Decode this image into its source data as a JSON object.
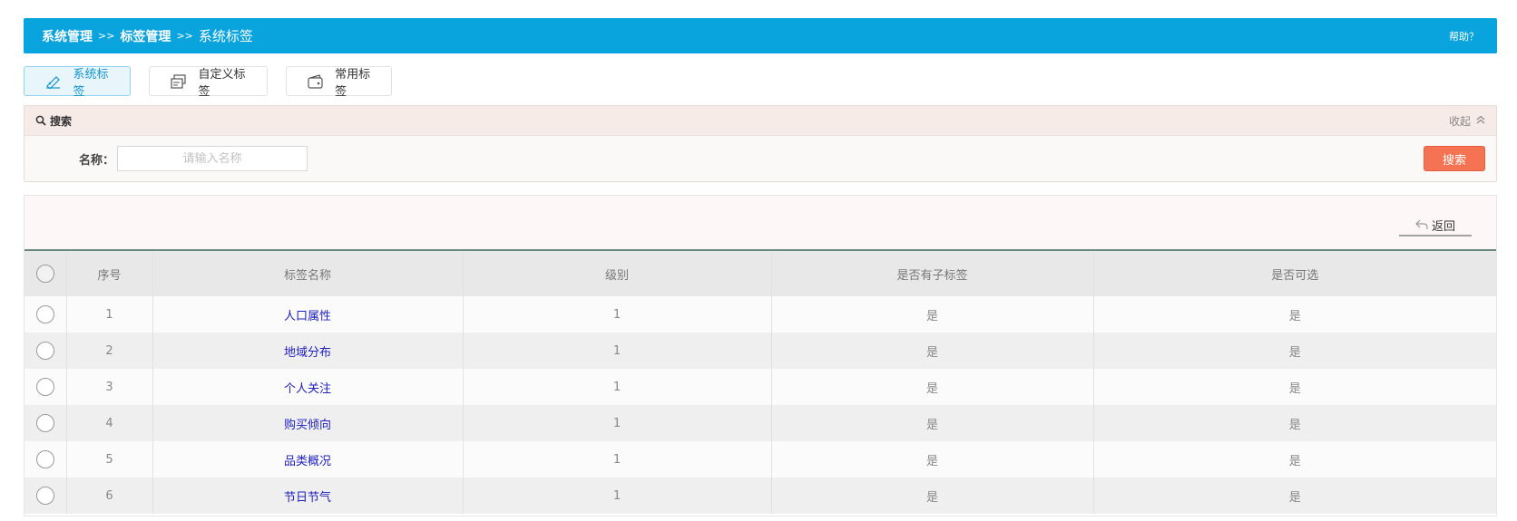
{
  "breadcrumb": {
    "items": [
      "系统管理",
      "标签管理",
      "系统标签"
    ],
    "separator": ">>"
  },
  "help_label": "帮助？",
  "tabs": [
    {
      "label": "系统标签",
      "icon": "edit-tag-icon",
      "active": true
    },
    {
      "label": "自定义标签",
      "icon": "card-stack-icon",
      "active": false
    },
    {
      "label": "常用标签",
      "icon": "wallet-icon",
      "active": false
    }
  ],
  "search": {
    "title": "搜索",
    "collapse_label": "收起",
    "name_label": "名称：",
    "name_placeholder": "请输入名称",
    "name_value": "",
    "button_label": "搜索"
  },
  "toolbar": {
    "back_label": "返回"
  },
  "table": {
    "columns": [
      "序号",
      "标签名称",
      "级别",
      "是否有子标签",
      "是否可选"
    ],
    "rows": [
      {
        "index": "1",
        "name": "人口属性",
        "level": "1",
        "has_children": "是",
        "selectable": "是"
      },
      {
        "index": "2",
        "name": "地域分布",
        "level": "1",
        "has_children": "是",
        "selectable": "是"
      },
      {
        "index": "3",
        "name": "个人关注",
        "level": "1",
        "has_children": "是",
        "selectable": "是"
      },
      {
        "index": "4",
        "name": "购买倾向",
        "level": "1",
        "has_children": "是",
        "selectable": "是"
      },
      {
        "index": "5",
        "name": "品类概况",
        "level": "1",
        "has_children": "是",
        "selectable": "是"
      },
      {
        "index": "6",
        "name": "节日节气",
        "level": "1",
        "has_children": "是",
        "selectable": "是"
      }
    ]
  },
  "colors": {
    "header_bar": "#09a3de",
    "search_button": "#f57352",
    "link": "#2020c0",
    "active_tab_text": "#1594cf"
  }
}
